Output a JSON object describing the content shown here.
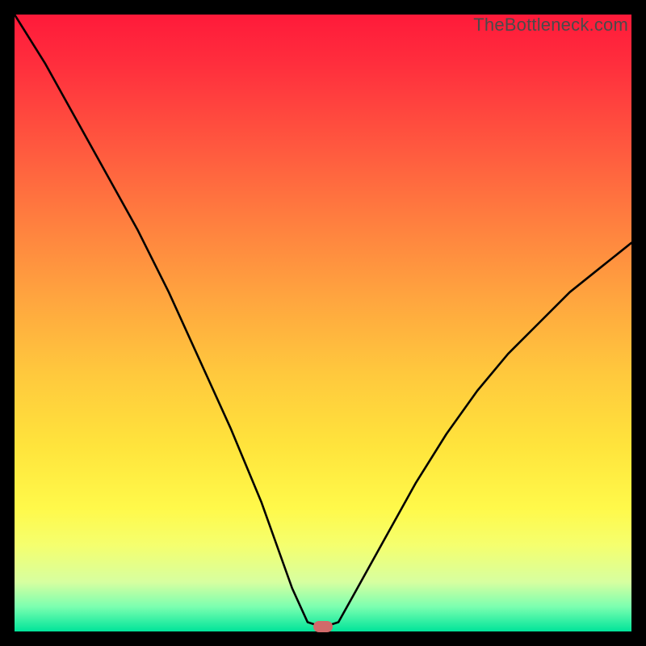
{
  "watermark": "TheBottleneck.com",
  "marker": {
    "x_frac": 0.5,
    "y_frac": 0.992
  },
  "chart_data": {
    "type": "line",
    "title": "",
    "xlabel": "",
    "ylabel": "",
    "xlim": [
      0,
      1
    ],
    "ylim": [
      0,
      1
    ],
    "series": [
      {
        "name": "curve",
        "x": [
          0.0,
          0.05,
          0.1,
          0.15,
          0.2,
          0.25,
          0.3,
          0.35,
          0.4,
          0.45,
          0.475,
          0.5,
          0.525,
          0.55,
          0.6,
          0.65,
          0.7,
          0.75,
          0.8,
          0.85,
          0.9,
          0.95,
          1.0
        ],
        "y": [
          1.0,
          0.92,
          0.83,
          0.74,
          0.65,
          0.55,
          0.44,
          0.33,
          0.21,
          0.07,
          0.015,
          0.007,
          0.015,
          0.06,
          0.15,
          0.24,
          0.32,
          0.39,
          0.45,
          0.5,
          0.55,
          0.59,
          0.63
        ]
      }
    ],
    "gradient_stops": [
      {
        "pos": 0.0,
        "color": "#ff1a3a"
      },
      {
        "pos": 0.08,
        "color": "#ff2e3d"
      },
      {
        "pos": 0.22,
        "color": "#ff5a3f"
      },
      {
        "pos": 0.33,
        "color": "#ff7d3f"
      },
      {
        "pos": 0.46,
        "color": "#ffa53f"
      },
      {
        "pos": 0.58,
        "color": "#ffc83d"
      },
      {
        "pos": 0.7,
        "color": "#ffe43c"
      },
      {
        "pos": 0.8,
        "color": "#fff94a"
      },
      {
        "pos": 0.86,
        "color": "#f5ff6e"
      },
      {
        "pos": 0.92,
        "color": "#d7ffa0"
      },
      {
        "pos": 0.96,
        "color": "#7bffb0"
      },
      {
        "pos": 1.0,
        "color": "#00e49a"
      }
    ],
    "marker_color": "#d16a6a"
  }
}
